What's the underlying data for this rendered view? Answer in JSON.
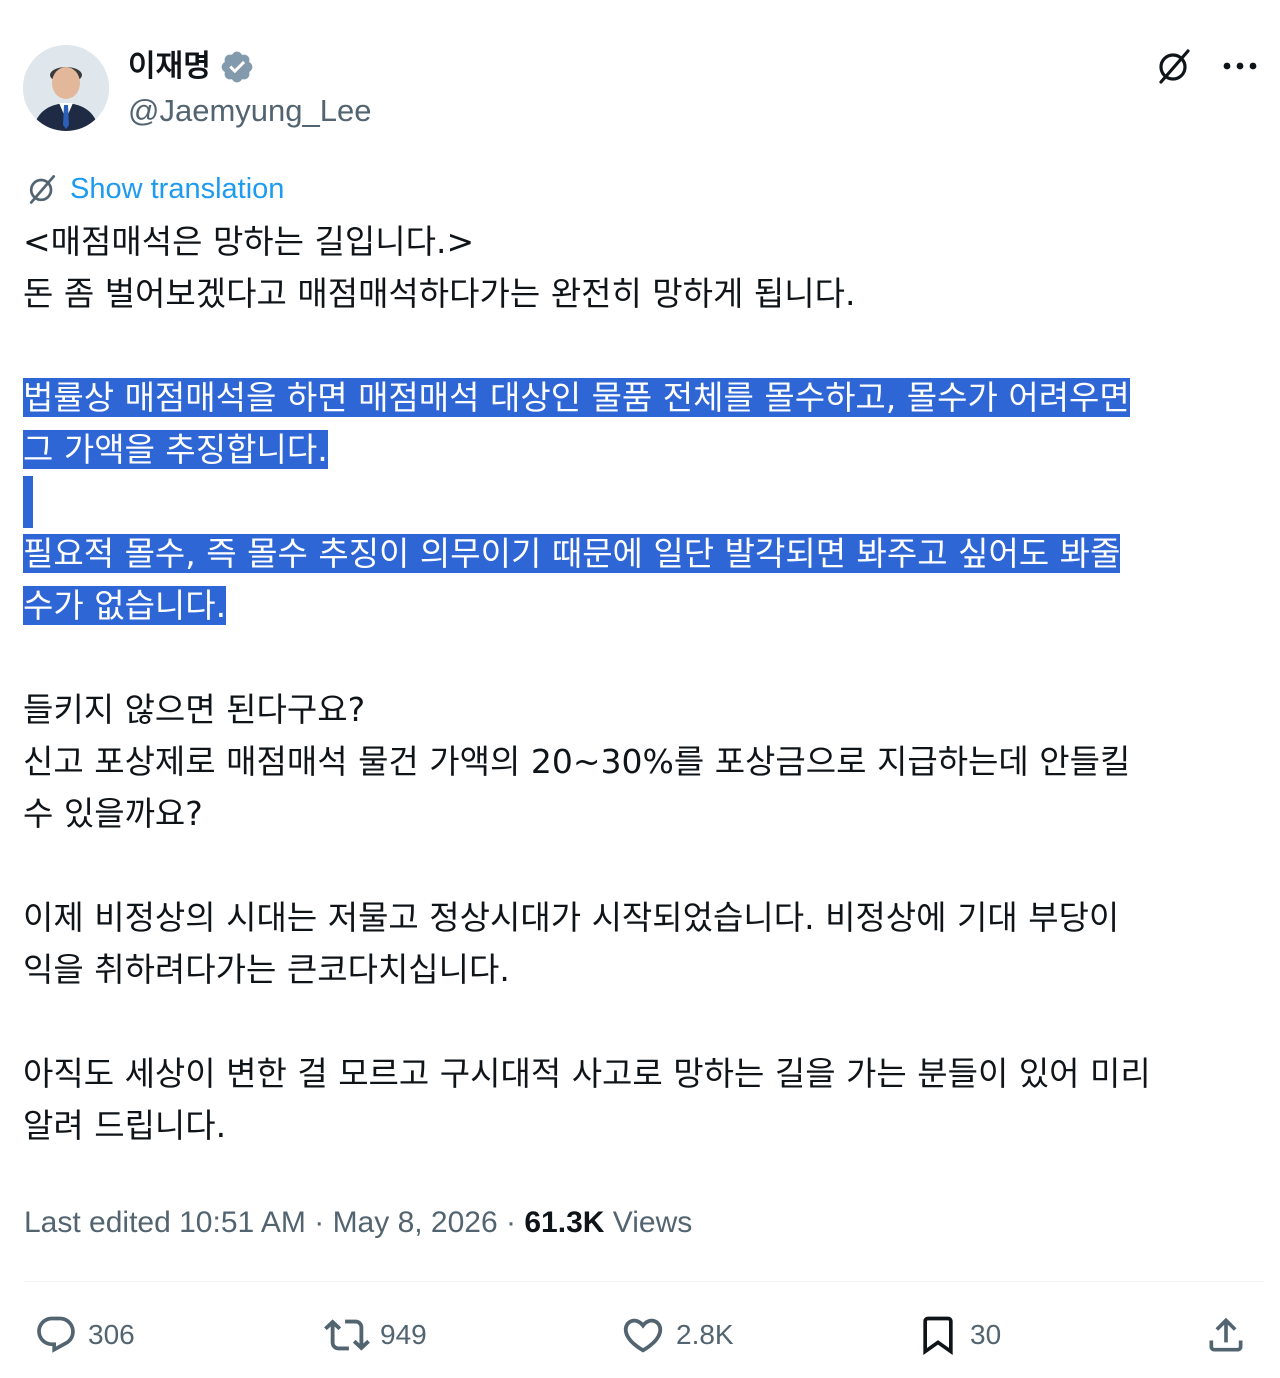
{
  "author": {
    "name": "이재명",
    "handle": "@Jaemyung_Lee",
    "verified_color": "#829aab"
  },
  "header_icons": [
    "grok-icon",
    "more-icon"
  ],
  "translate_label": "Show translation",
  "accent_color": "#1d9bf0",
  "selection_color": "#2f66d6",
  "paragraphs": [
    {
      "lines": [
        "<매점매석은 망하는 길입니다.>",
        "돈 좀 벌어보겠다고 매점매석하다가는 완전히 망하게 됩니다."
      ],
      "highlight": false
    },
    {
      "lines": [
        "법률상 매점매석을 하면 매점매석 대상인 물품 전체를 몰수하고, 몰수가 어려우면",
        "그 가액을 추징합니다."
      ],
      "highlight": true
    },
    {
      "lines": [
        "필요적 몰수, 즉 몰수 추징이 의무이기 때문에 일단 발각되면 봐주고 싶어도 봐줄",
        "수가 없습니다."
      ],
      "highlight": true
    },
    {
      "lines": [
        "들키지 않으면 된다구요?",
        "신고 포상제로 매점매석 물건 가액의 20~30%를 포상금으로 지급하는데 안들킬",
        "수 있을까요?"
      ],
      "highlight": false
    },
    {
      "lines": [
        "이제 비정상의 시대는 저물고 정상시대가 시작되었습니다. 비정상에 기대 부당이",
        "익을 취하려다가는 큰코다치십니다."
      ],
      "highlight": false
    },
    {
      "lines": [
        "아직도 세상이 변한 걸 모르고 구시대적 사고로 망하는 길을 가는 분들이 있어 미리",
        "알려 드립니다."
      ],
      "highlight": false
    }
  ],
  "meta": {
    "edited": "Last edited 10:51 AM",
    "sep1": "·",
    "date": "May 8, 2026",
    "sep2": "·",
    "views_count": "61.3K",
    "views_label": "Views"
  },
  "actions": {
    "replies": "306",
    "reposts": "949",
    "likes": "2.8K",
    "bookmarks": "30"
  }
}
